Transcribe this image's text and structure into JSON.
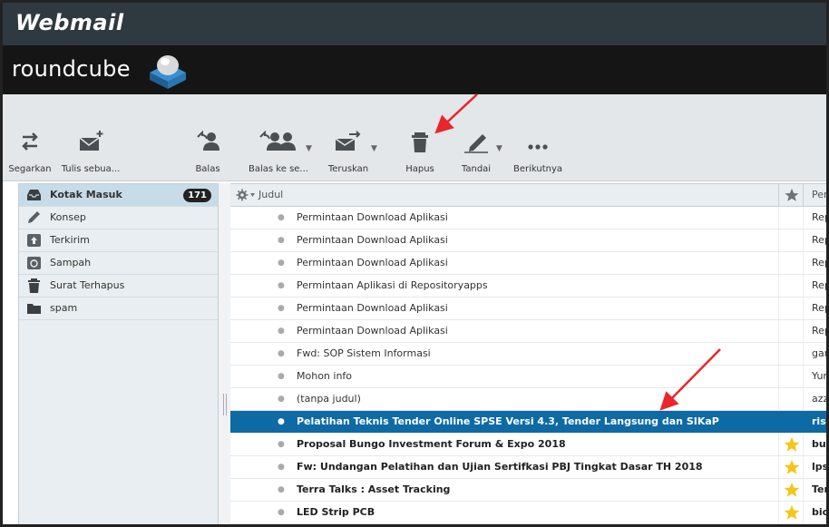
{
  "header": {
    "brand": "Webmail",
    "logo_text": "roundcube"
  },
  "toolbar": {
    "refresh": "Segarkan",
    "compose": "Tulis sebua...",
    "reply": "Balas",
    "reply_all": "Balas ke se...",
    "forward": "Teruskan",
    "delete": "Hapus",
    "mark": "Tandai",
    "more": "Berikutnya"
  },
  "folders": [
    {
      "label": "Kotak Masuk",
      "icon": "inbox-icon",
      "count": "171",
      "active": true
    },
    {
      "label": "Konsep",
      "icon": "pencil-icon"
    },
    {
      "label": "Terkirim",
      "icon": "sent-icon"
    },
    {
      "label": "Sampah",
      "icon": "junk-icon"
    },
    {
      "label": "Surat Terhapus",
      "icon": "trash-icon"
    },
    {
      "label": "spam",
      "icon": "folder-icon"
    }
  ],
  "list": {
    "subject_header": "Judul",
    "from_header": "Pen",
    "rows": [
      {
        "subject": "Permintaan Download Aplikasi",
        "from": "Rep"
      },
      {
        "subject": "Permintaan Download Aplikasi",
        "from": "Rep"
      },
      {
        "subject": "Permintaan Download Aplikasi",
        "from": "Rep"
      },
      {
        "subject": "Permintaan Aplikasi di Repositoryapps",
        "from": "Rep"
      },
      {
        "subject": "Permintaan Download Aplikasi",
        "from": "Rep"
      },
      {
        "subject": "Permintaan Download Aplikasi",
        "from": "Rep"
      },
      {
        "subject": "Fwd: SOP Sistem Informasi",
        "from": "gan"
      },
      {
        "subject": "Mohon info",
        "from": "Yun"
      },
      {
        "subject": "(tanpa judul)",
        "from": "azz"
      },
      {
        "subject": "Pelatihan Teknis Tender Online SPSE Versi 4.3, Tender Langsung dan SIKaP",
        "from": "risw"
      },
      {
        "subject": "Proposal Bungo Investment Forum & Expo 2018",
        "from": "bun"
      },
      {
        "subject": "Fw: Undangan Pelatihan dan Ujian Sertifkasi PBJ Tingkat Dasar TH 2018",
        "from": "lpse"
      },
      {
        "subject": "Terra Talks : Asset Tracking",
        "from": "Ter"
      },
      {
        "subject": "LED Strip PCB",
        "from": "bicl"
      }
    ]
  },
  "colors": {
    "selected": "#0e6aa5",
    "star": "#f5c518",
    "arrow": "#e8262b"
  }
}
